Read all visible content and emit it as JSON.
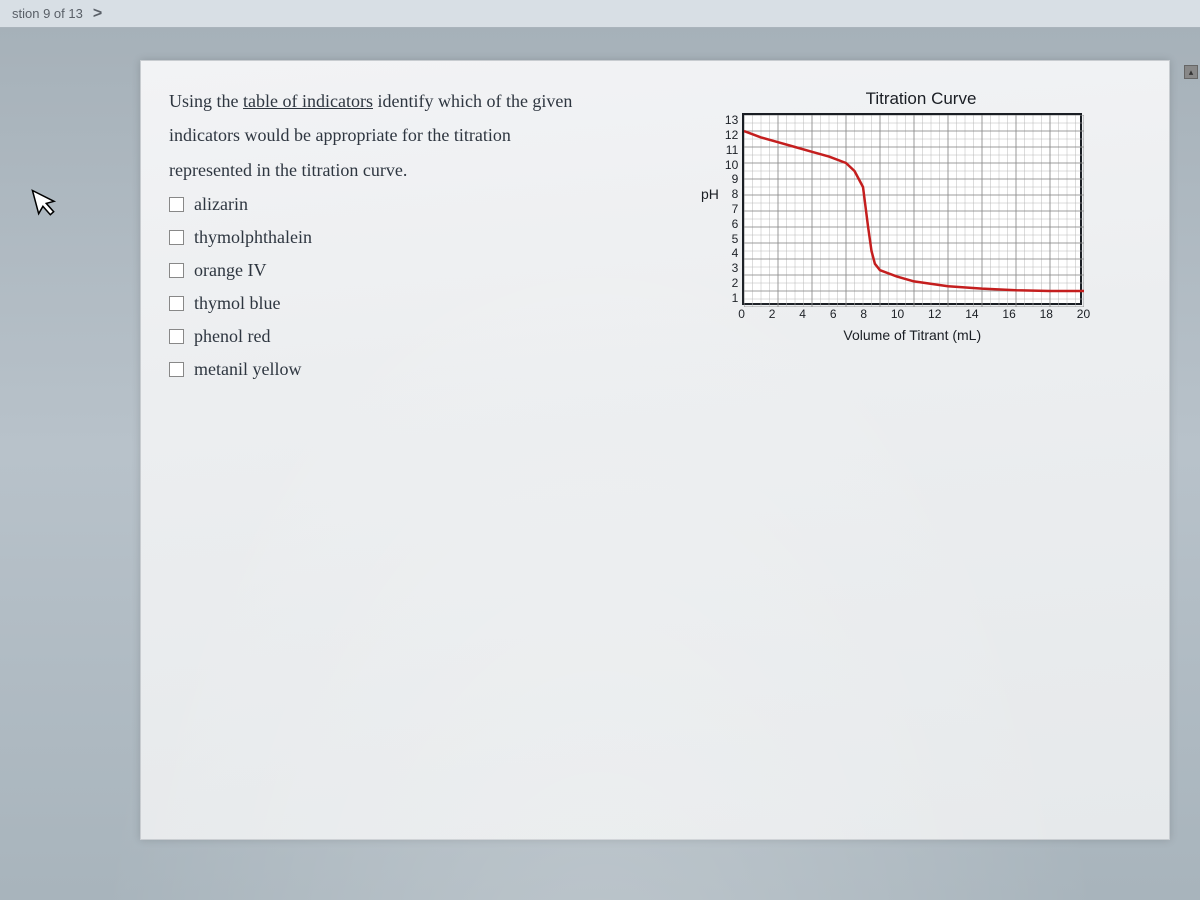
{
  "topbar": {
    "question_nav": "stion 9 of 13",
    "chevron": ">"
  },
  "prompt": {
    "line1_prefix": "Using the ",
    "link": "table of indicators",
    "line1_suffix": " identify which of the given",
    "line2": "indicators would be appropriate for the titration",
    "line3": "represented in the titration curve."
  },
  "options": [
    {
      "label": "alizarin"
    },
    {
      "label": "thymolphthalein"
    },
    {
      "label": "orange IV"
    },
    {
      "label": "thymol blue"
    },
    {
      "label": "phenol red"
    },
    {
      "label": "metanil yellow"
    }
  ],
  "chart_data": {
    "type": "line",
    "title": "Titration Curve",
    "xlabel": "Volume of Titrant (mL)",
    "ylabel": "pH",
    "xlim": [
      0,
      20
    ],
    "ylim": [
      1,
      13
    ],
    "xticks": [
      0,
      2,
      4,
      6,
      8,
      10,
      12,
      14,
      16,
      18,
      20
    ],
    "yticks": [
      13,
      12,
      11,
      10,
      9,
      8,
      7,
      6,
      5,
      4,
      3,
      2,
      1
    ],
    "series": [
      {
        "name": "pH",
        "x": [
          0,
          1,
          2,
          3,
          4,
          5,
          6,
          6.5,
          7,
          7.3,
          7.5,
          7.7,
          8,
          9,
          10,
          12,
          14,
          16,
          18,
          20
        ],
        "y": [
          12.0,
          11.6,
          11.3,
          11.0,
          10.7,
          10.4,
          10.0,
          9.5,
          8.5,
          6.0,
          4.5,
          3.7,
          3.3,
          2.9,
          2.6,
          2.3,
          2.15,
          2.05,
          2.0,
          2.0
        ]
      }
    ]
  }
}
